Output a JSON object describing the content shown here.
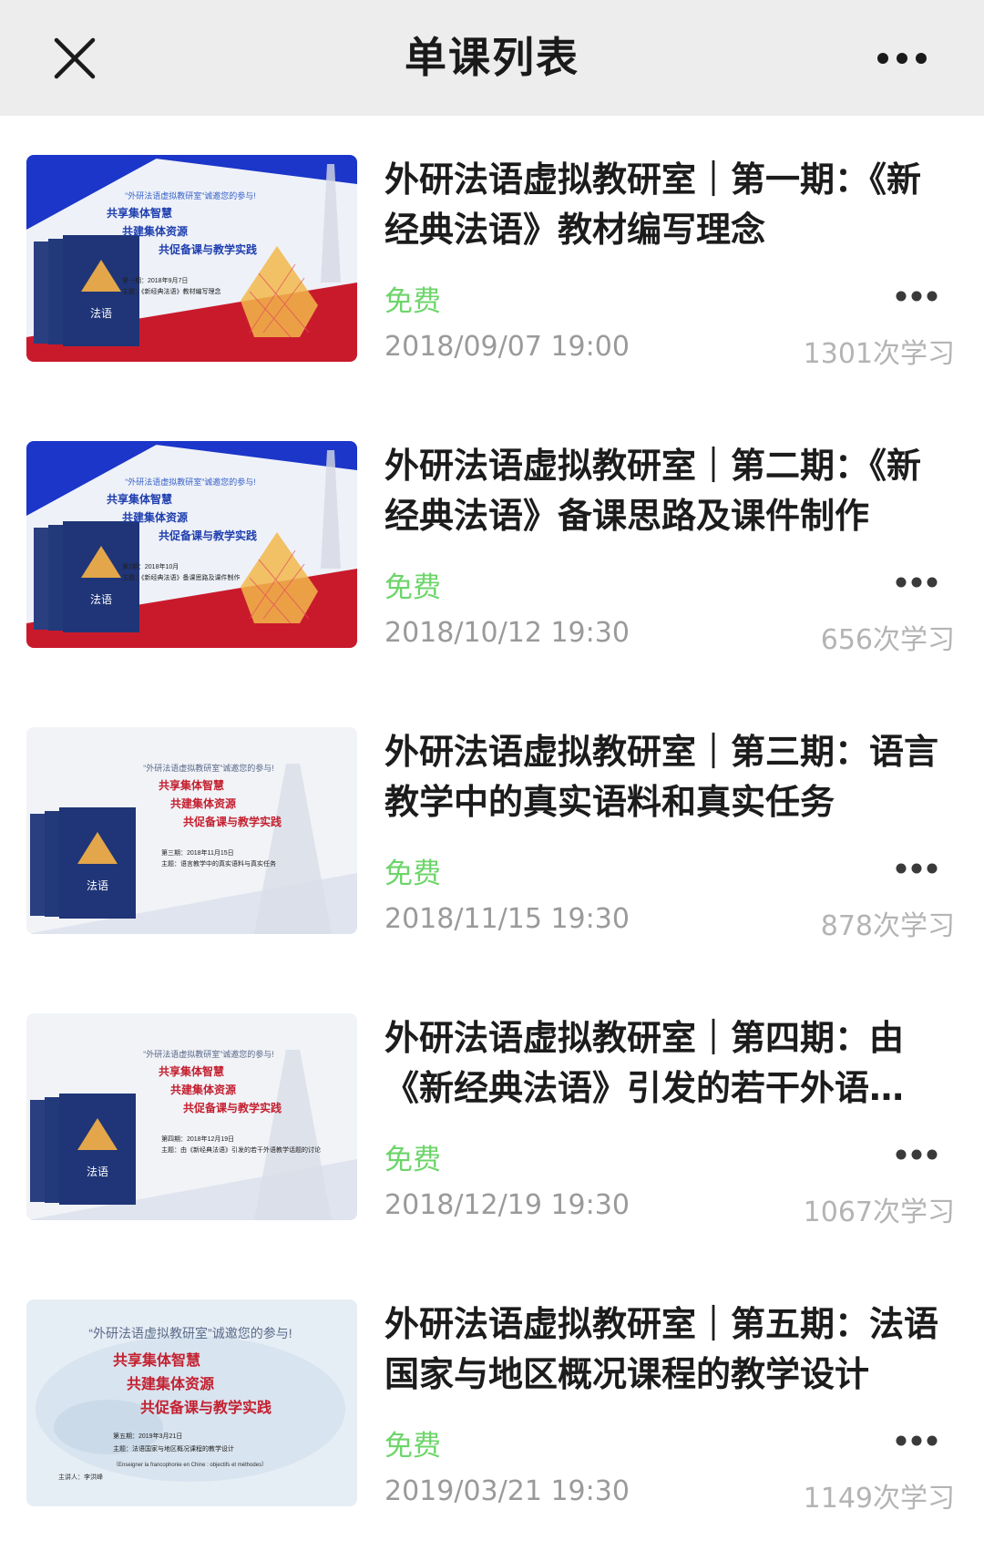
{
  "header": {
    "title": "单课列表",
    "close_icon": "close-icon",
    "more_icon": "more-horizontal-icon"
  },
  "colors": {
    "nav_bg": "#ededed",
    "free_green": "#6dd56a",
    "meta_gray": "#9a9a9a",
    "banner_blue": "#1b36c9",
    "banner_red": "#c91a2c"
  },
  "courses": [
    {
      "title": "外研法语虚拟教研室｜第一期：《新经典法语》教材编写理念",
      "price": "免费",
      "date": "2018/09/07 19:00",
      "count": "1301次学习",
      "thumb": {
        "invite": "“外研法语虚拟教研室”诚邀您的参与!",
        "line1": "共享集体智慧",
        "line2": "共建集体资源",
        "line3": "共促备课与教学实践",
        "book": "法语",
        "info1": "第一期：2018年9月7日",
        "info2": "主题：《新经典法语》教材编写理念"
      }
    },
    {
      "title": "外研法语虚拟教研室｜第二期：《新经典法语》备课思路及课件制作",
      "price": "免费",
      "date": "2018/10/12 19:30",
      "count": "656次学习",
      "thumb": {
        "invite": "“外研法语虚拟教研室”诚邀您的参与!",
        "line1": "共享集体智慧",
        "line2": "共建集体资源",
        "line3": "共促备课与教学实践",
        "book": "法语",
        "info1": "第2期：2018年10月",
        "info2": "主题：《新经典法语》备课思路及课件制作"
      }
    },
    {
      "title": "外研法语虚拟教研室｜第三期：语言教学中的真实语料和真实任务",
      "price": "免费",
      "date": "2018/11/15 19:30",
      "count": "878次学习",
      "thumb": {
        "invite": "“外研法语虚拟教研室”诚邀您的参与!",
        "line1": "共享集体智慧",
        "line2": "共建集体资源",
        "line3": "共促备课与教学实践",
        "book": "法语",
        "info1": "第三期：2018年11月15日",
        "info2": "主题：语言教学中的真实语料与真实任务"
      }
    },
    {
      "title": "外研法语虚拟教研室｜第四期：由《新经典法语》引发的若干外语…",
      "price": "免费",
      "date": "2018/12/19 19:30",
      "count": "1067次学习",
      "thumb": {
        "invite": "“外研法语虚拟教研室”诚邀您的参与!",
        "line1": "共享集体智慧",
        "line2": "共建集体资源",
        "line3": "共促备课与教学实践",
        "book": "法语",
        "info1": "第四期：2018年12月19日",
        "info2": "主题：由《新经典法语》引发的若干外语教学话题的讨论"
      }
    },
    {
      "title": "外研法语虚拟教研室｜第五期：法语国家与地区概况课程的教学设计",
      "price": "免费",
      "date": "2019/03/21 19:30",
      "count": "1149次学习",
      "thumb": {
        "invite": "“外研法语虚拟教研室”诚邀您的参与!",
        "line1": "共享集体智慧",
        "line2": "共建集体资源",
        "line3": "共促备课与教学实践",
        "book": "",
        "info1": "第五期：2019年3月21日",
        "info2": "主题：法语国家与地区概况课程的教学设计",
        "info3": "（Enseigner la francophonie en Chine : objectifs et méthodes）",
        "info4": "主讲人：李洪峰"
      }
    }
  ]
}
